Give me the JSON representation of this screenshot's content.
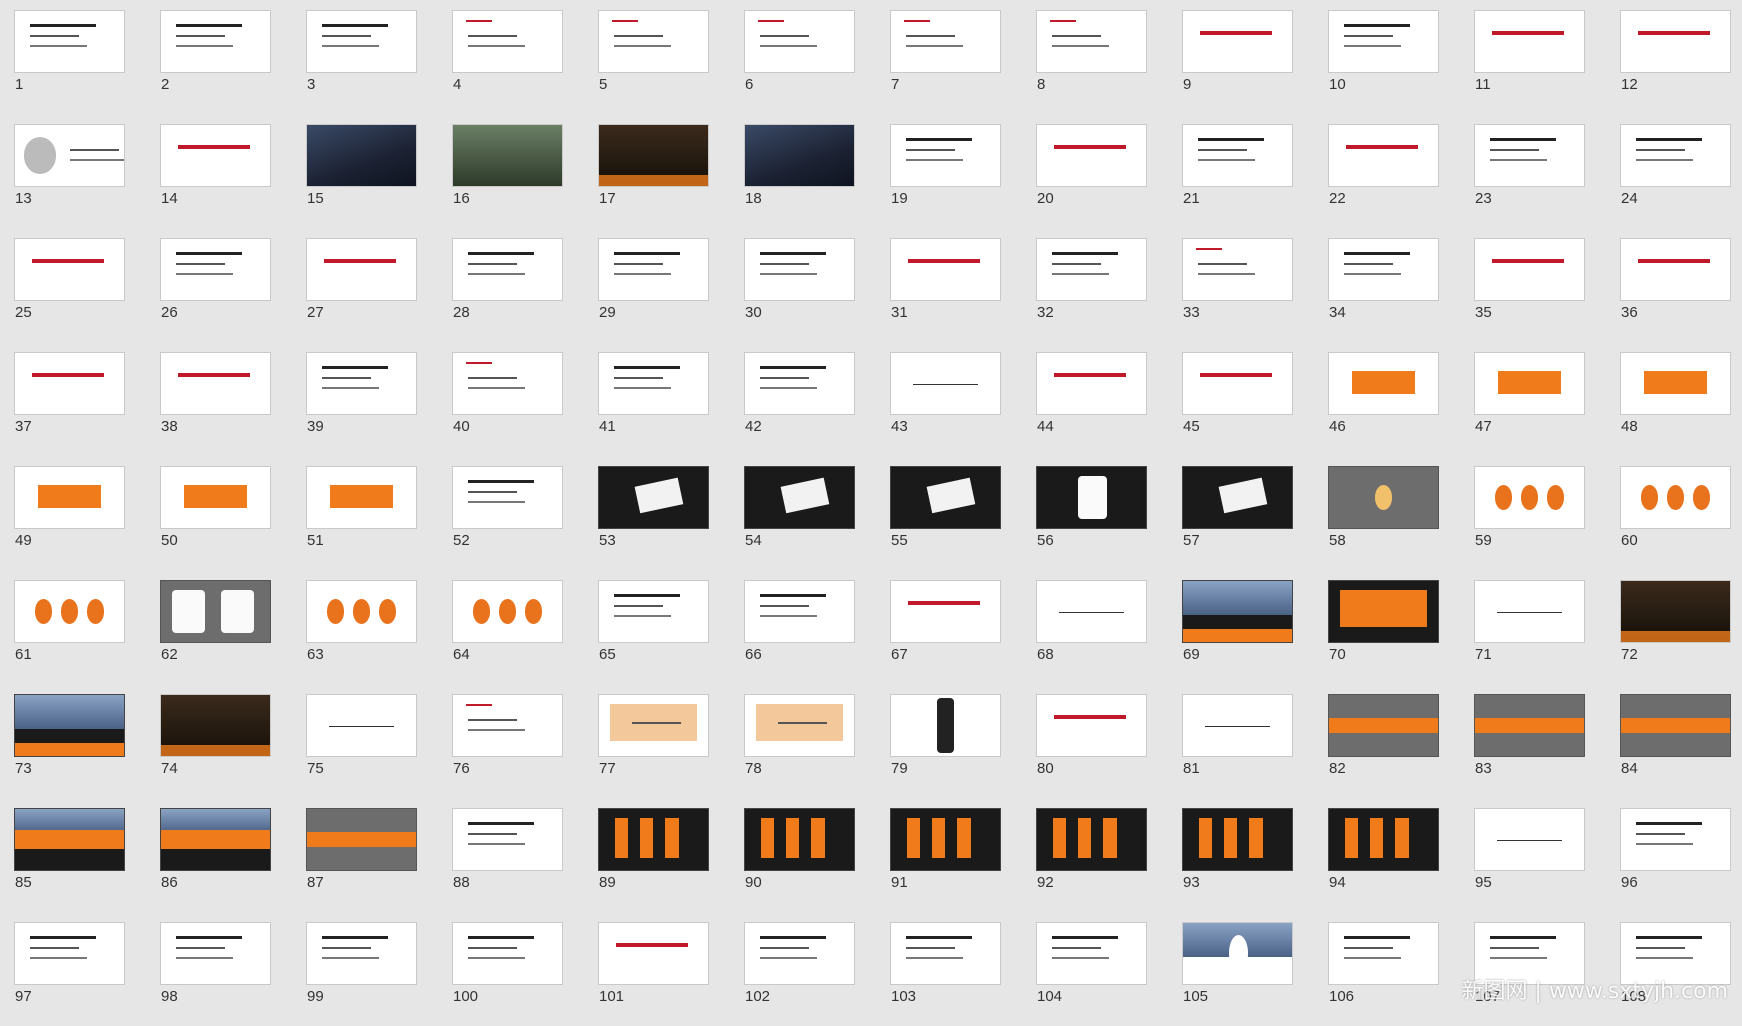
{
  "slides": [
    {
      "n": "1",
      "t": "text"
    },
    {
      "n": "2",
      "t": "text"
    },
    {
      "n": "3",
      "t": "text"
    },
    {
      "n": "4",
      "t": "redtext"
    },
    {
      "n": "5",
      "t": "redtext"
    },
    {
      "n": "6",
      "t": "redtext"
    },
    {
      "n": "7",
      "t": "redtext"
    },
    {
      "n": "8",
      "t": "redtext"
    },
    {
      "n": "9",
      "t": "redtitle"
    },
    {
      "n": "10",
      "t": "text"
    },
    {
      "n": "11",
      "t": "redtitle"
    },
    {
      "n": "12",
      "t": "redtitle"
    },
    {
      "n": "13",
      "t": "diagram"
    },
    {
      "n": "14",
      "t": "redtitle"
    },
    {
      "n": "15",
      "t": "photo"
    },
    {
      "n": "16",
      "t": "photo2"
    },
    {
      "n": "17",
      "t": "brown"
    },
    {
      "n": "18",
      "t": "photo"
    },
    {
      "n": "19",
      "t": "text"
    },
    {
      "n": "20",
      "t": "redtitle"
    },
    {
      "n": "21",
      "t": "text"
    },
    {
      "n": "22",
      "t": "redtitle"
    },
    {
      "n": "23",
      "t": "text"
    },
    {
      "n": "24",
      "t": "text"
    },
    {
      "n": "25",
      "t": "redtitle"
    },
    {
      "n": "26",
      "t": "text"
    },
    {
      "n": "27",
      "t": "redtitle"
    },
    {
      "n": "28",
      "t": "text"
    },
    {
      "n": "29",
      "t": "text"
    },
    {
      "n": "30",
      "t": "text"
    },
    {
      "n": "31",
      "t": "redtitle"
    },
    {
      "n": "32",
      "t": "text"
    },
    {
      "n": "33",
      "t": "redtext"
    },
    {
      "n": "34",
      "t": "text"
    },
    {
      "n": "35",
      "t": "redtitle"
    },
    {
      "n": "36",
      "t": "redtitle"
    },
    {
      "n": "37",
      "t": "redtitle"
    },
    {
      "n": "38",
      "t": "redtitle"
    },
    {
      "n": "39",
      "t": "text"
    },
    {
      "n": "40",
      "t": "redtext"
    },
    {
      "n": "41",
      "t": "text"
    },
    {
      "n": "42",
      "t": "text"
    },
    {
      "n": "43",
      "t": "line"
    },
    {
      "n": "44",
      "t": "redtitle"
    },
    {
      "n": "45",
      "t": "redtitle"
    },
    {
      "n": "46",
      "t": "orange"
    },
    {
      "n": "47",
      "t": "orange"
    },
    {
      "n": "48",
      "t": "orange"
    },
    {
      "n": "49",
      "t": "orange"
    },
    {
      "n": "50",
      "t": "orange"
    },
    {
      "n": "51",
      "t": "orange"
    },
    {
      "n": "52",
      "t": "text"
    },
    {
      "n": "53",
      "t": "darkcard"
    },
    {
      "n": "54",
      "t": "darkcard"
    },
    {
      "n": "55",
      "t": "darkcard"
    },
    {
      "n": "56",
      "t": "darktee"
    },
    {
      "n": "57",
      "t": "darkcard"
    },
    {
      "n": "58",
      "t": "gray"
    },
    {
      "n": "59",
      "t": "circles"
    },
    {
      "n": "60",
      "t": "circles"
    },
    {
      "n": "61",
      "t": "circles"
    },
    {
      "n": "62",
      "t": "grayt"
    },
    {
      "n": "63",
      "t": "circles"
    },
    {
      "n": "64",
      "t": "circles"
    },
    {
      "n": "65",
      "t": "text"
    },
    {
      "n": "66",
      "t": "text"
    },
    {
      "n": "67",
      "t": "redtitle"
    },
    {
      "n": "68",
      "t": "line"
    },
    {
      "n": "69",
      "t": "darksky"
    },
    {
      "n": "70",
      "t": "darkorange"
    },
    {
      "n": "71",
      "t": "line"
    },
    {
      "n": "72",
      "t": "brown"
    },
    {
      "n": "73",
      "t": "darksky"
    },
    {
      "n": "74",
      "t": "brown"
    },
    {
      "n": "75",
      "t": "line"
    },
    {
      "n": "76",
      "t": "redtext"
    },
    {
      "n": "77",
      "t": "orangeframe"
    },
    {
      "n": "78",
      "t": "orangeframe"
    },
    {
      "n": "79",
      "t": "phone"
    },
    {
      "n": "80",
      "t": "redtitle"
    },
    {
      "n": "81",
      "t": "line"
    },
    {
      "n": "82",
      "t": "graystrip"
    },
    {
      "n": "83",
      "t": "graystrip"
    },
    {
      "n": "84",
      "t": "graystrip"
    },
    {
      "n": "85",
      "t": "darkstrip"
    },
    {
      "n": "86",
      "t": "darkstrip"
    },
    {
      "n": "87",
      "t": "graystrip"
    },
    {
      "n": "88",
      "t": "text"
    },
    {
      "n": "89",
      "t": "pillars"
    },
    {
      "n": "90",
      "t": "pillars"
    },
    {
      "n": "91",
      "t": "pillars"
    },
    {
      "n": "92",
      "t": "pillars"
    },
    {
      "n": "93",
      "t": "pillars"
    },
    {
      "n": "94",
      "t": "pillars"
    },
    {
      "n": "95",
      "t": "line"
    },
    {
      "n": "96",
      "t": "text"
    },
    {
      "n": "97",
      "t": "text"
    },
    {
      "n": "98",
      "t": "text"
    },
    {
      "n": "99",
      "t": "text"
    },
    {
      "n": "100",
      "t": "text"
    },
    {
      "n": "101",
      "t": "redtitle"
    },
    {
      "n": "102",
      "t": "text"
    },
    {
      "n": "103",
      "t": "text"
    },
    {
      "n": "104",
      "t": "text"
    },
    {
      "n": "105",
      "t": "panda"
    },
    {
      "n": "106",
      "t": "text"
    },
    {
      "n": "107",
      "t": "text"
    },
    {
      "n": "108",
      "t": "text"
    }
  ],
  "watermark": "新图网 | www.sxtyjh.com",
  "colors": {
    "background": "#e6e6e6",
    "accent_red": "#c0192a",
    "accent_orange": "#ef7b1a"
  }
}
